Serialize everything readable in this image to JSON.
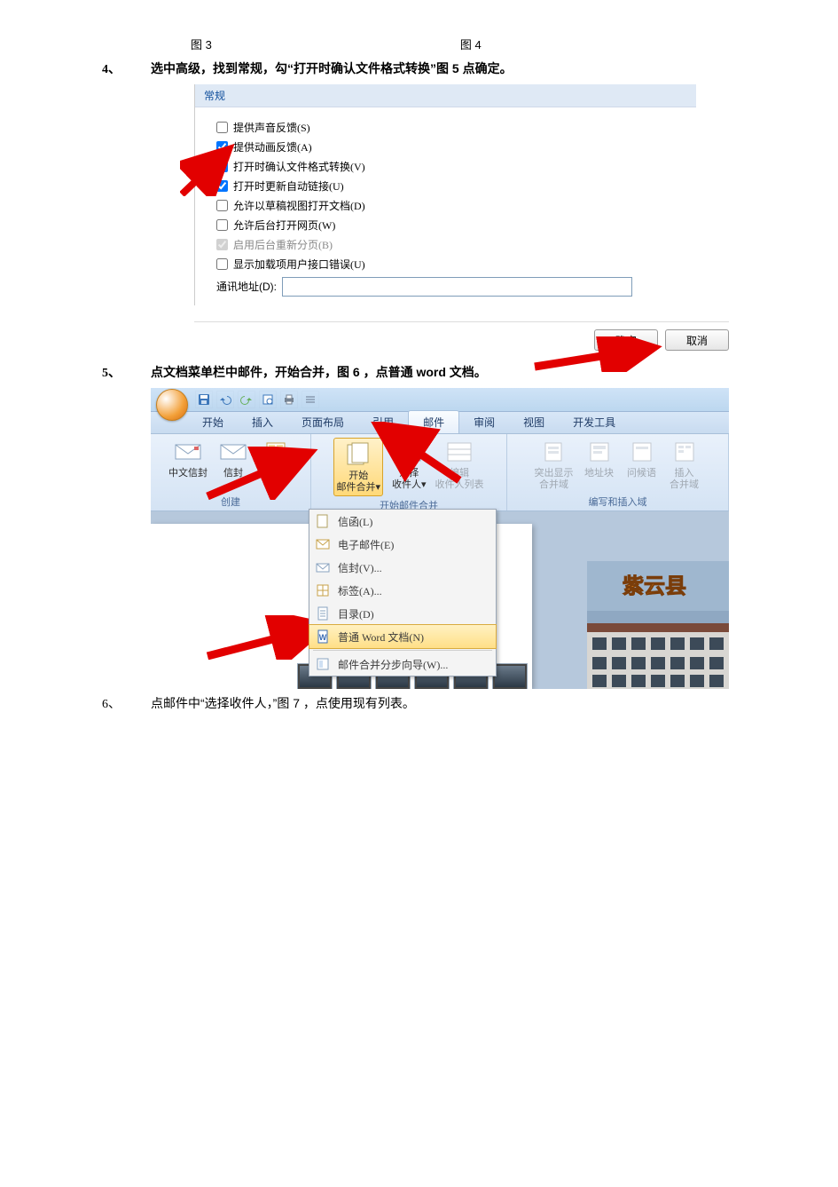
{
  "captions": {
    "fig3": "图 3",
    "fig4": "图 4"
  },
  "step4": {
    "num": "4、",
    "text": "选中高级，找到常规，勾“打开时确认文件格式转换”图 5  点确定。"
  },
  "options_panel": {
    "header": "常规",
    "items": [
      {
        "label": "提供声音反馈(S)",
        "checked": false,
        "disabled": false
      },
      {
        "label": "提供动画反馈(A)",
        "checked": true,
        "disabled": false
      },
      {
        "label": "打开时确认文件格式转换(V)",
        "checked": true,
        "disabled": false
      },
      {
        "label": "打开时更新自动链接(U)",
        "checked": true,
        "disabled": false
      },
      {
        "label": "允许以草稿视图打开文档(D)",
        "checked": false,
        "disabled": false
      },
      {
        "label": "允许后台打开网页(W)",
        "checked": false,
        "disabled": false
      },
      {
        "label": "启用后台重新分页(B)",
        "checked": true,
        "disabled": true
      },
      {
        "label": "显示加载项用户接口错误(U)",
        "checked": false,
        "disabled": false
      }
    ],
    "address_label": "通讯地址(D):",
    "address_value": "",
    "ok": "确定",
    "cancel": "取消"
  },
  "step5": {
    "num": "5、",
    "text": "点文档菜单栏中邮件，开始合并，图 6 ，点普通 word  文档。"
  },
  "ribbon": {
    "tabs": [
      "开始",
      "插入",
      "页面布局",
      "引用",
      "邮件",
      "审阅",
      "视图",
      "开发工具"
    ],
    "active_tab_index": 4,
    "groups": {
      "create": {
        "label": "创建",
        "btns": [
          "中文信封",
          "信封",
          "标签"
        ]
      },
      "start_merge": {
        "label": "开始邮件合并",
        "btns": [
          {
            "label1": "开始",
            "label2": "邮件合并▾"
          },
          {
            "label1": "选择",
            "label2": "收件人▾"
          },
          {
            "label1": "编辑",
            "label2": "收件人列表"
          }
        ]
      },
      "write_insert": {
        "label": "编写和插入域",
        "btns": [
          {
            "label1": "突出显示",
            "label2": "合并域"
          },
          {
            "label1": "地址块",
            "label2": ""
          },
          {
            "label1": "问候语",
            "label2": ""
          },
          {
            "label1": "插入",
            "label2": "合并域"
          }
        ]
      }
    },
    "menu": [
      "信函(L)",
      "电子邮件(E)",
      "信封(V)...",
      "标签(A)...",
      "目录(D)",
      "普通 Word 文档(N)",
      "邮件合并分步向导(W)..."
    ],
    "menu_selected_index": 5,
    "photo_caption": "紫云县"
  },
  "step6": {
    "num": "6、",
    "text": "点邮件中“选择收件人，”图 7 ，点使用现有列表。"
  }
}
